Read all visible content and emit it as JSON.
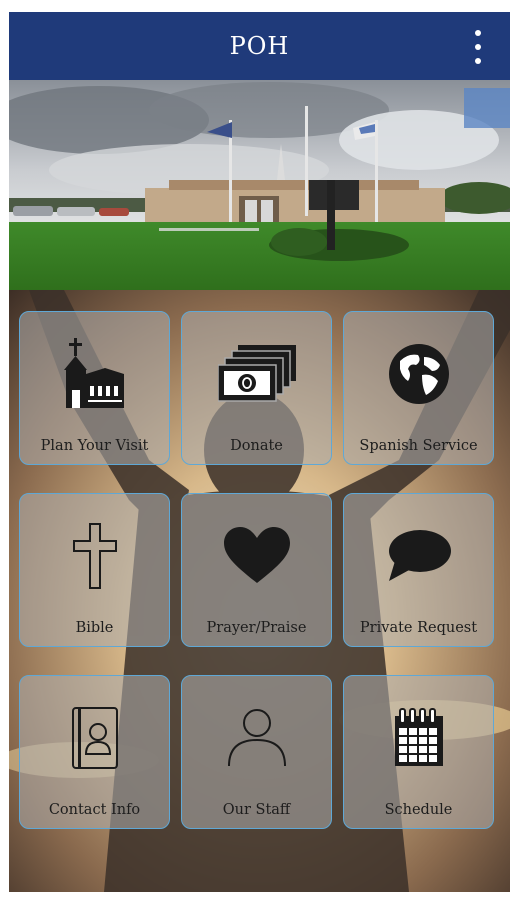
{
  "app": {
    "title": "POH"
  },
  "header": {
    "menu_icon": "overflow-menu-icon"
  },
  "hero": {
    "description": "church-building-photo"
  },
  "tiles": [
    {
      "label": "Plan Your Visit",
      "icon": "church-icon"
    },
    {
      "label": "Donate",
      "icon": "money-icon"
    },
    {
      "label": "Spanish Service",
      "icon": "globe-icon"
    },
    {
      "label": "Bible",
      "icon": "cross-icon"
    },
    {
      "label": "Prayer/Praise",
      "icon": "heart-icon"
    },
    {
      "label": "Private Request",
      "icon": "speech-bubble-icon"
    },
    {
      "label": "Contact Info",
      "icon": "contact-book-icon"
    },
    {
      "label": "Our Staff",
      "icon": "person-icon"
    },
    {
      "label": "Schedule",
      "icon": "calendar-icon"
    }
  ],
  "colors": {
    "appbar": "#1f3a7a",
    "tile_border": "#5fa8d6",
    "tile_fill": "#afafaf"
  }
}
